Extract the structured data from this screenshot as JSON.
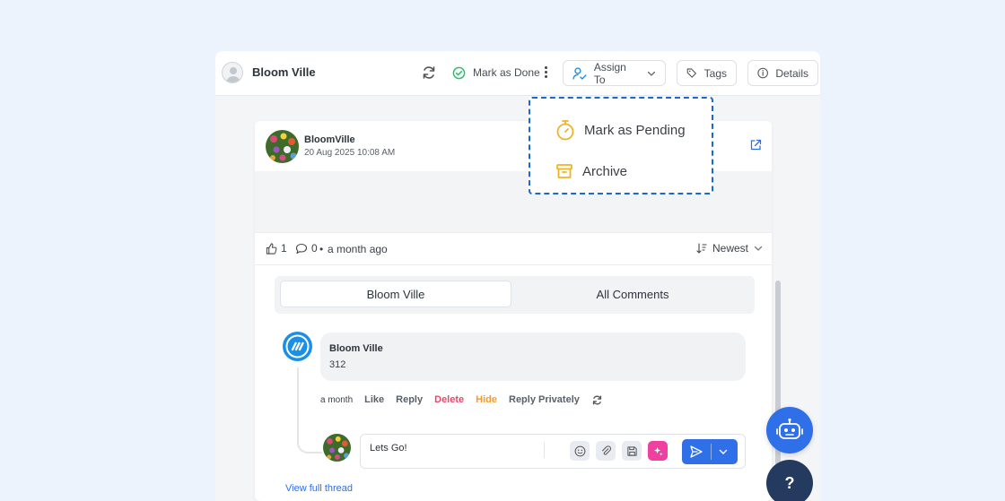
{
  "header": {
    "contact_name": "Bloom Ville",
    "mark_done_label": "Mark as Done",
    "assign_label": "Assign To",
    "tags_label": "Tags",
    "details_label": "Details"
  },
  "dropdown": {
    "items": [
      {
        "label": "Mark as Pending",
        "icon": "stopwatch-icon"
      },
      {
        "label": "Archive",
        "icon": "archive-icon"
      }
    ]
  },
  "post": {
    "author": "BloomVille",
    "date": "20 Aug 2025 10:08 AM",
    "likes": "1",
    "comments": "0",
    "separator": "•",
    "time_ago": "a month ago",
    "sort_label": "Newest"
  },
  "tabs": [
    "Bloom Ville",
    "All Comments"
  ],
  "comment": {
    "author": "Bloom Ville",
    "text": "312",
    "time": "a month",
    "actions": {
      "like": "Like",
      "reply": "Reply",
      "delete": "Delete",
      "hide": "Hide",
      "reply_privately": "Reply Privately"
    }
  },
  "reply": {
    "value": "Lets Go!"
  },
  "view_thread": "View full thread",
  "help_label": "?",
  "colors": {
    "accent": "#2f6fe8",
    "delete": "#e8476c",
    "hide": "#f39a2b",
    "pending": "#f0b323",
    "done": "#2dbf6b",
    "dropdown_border": "#1769d3"
  }
}
